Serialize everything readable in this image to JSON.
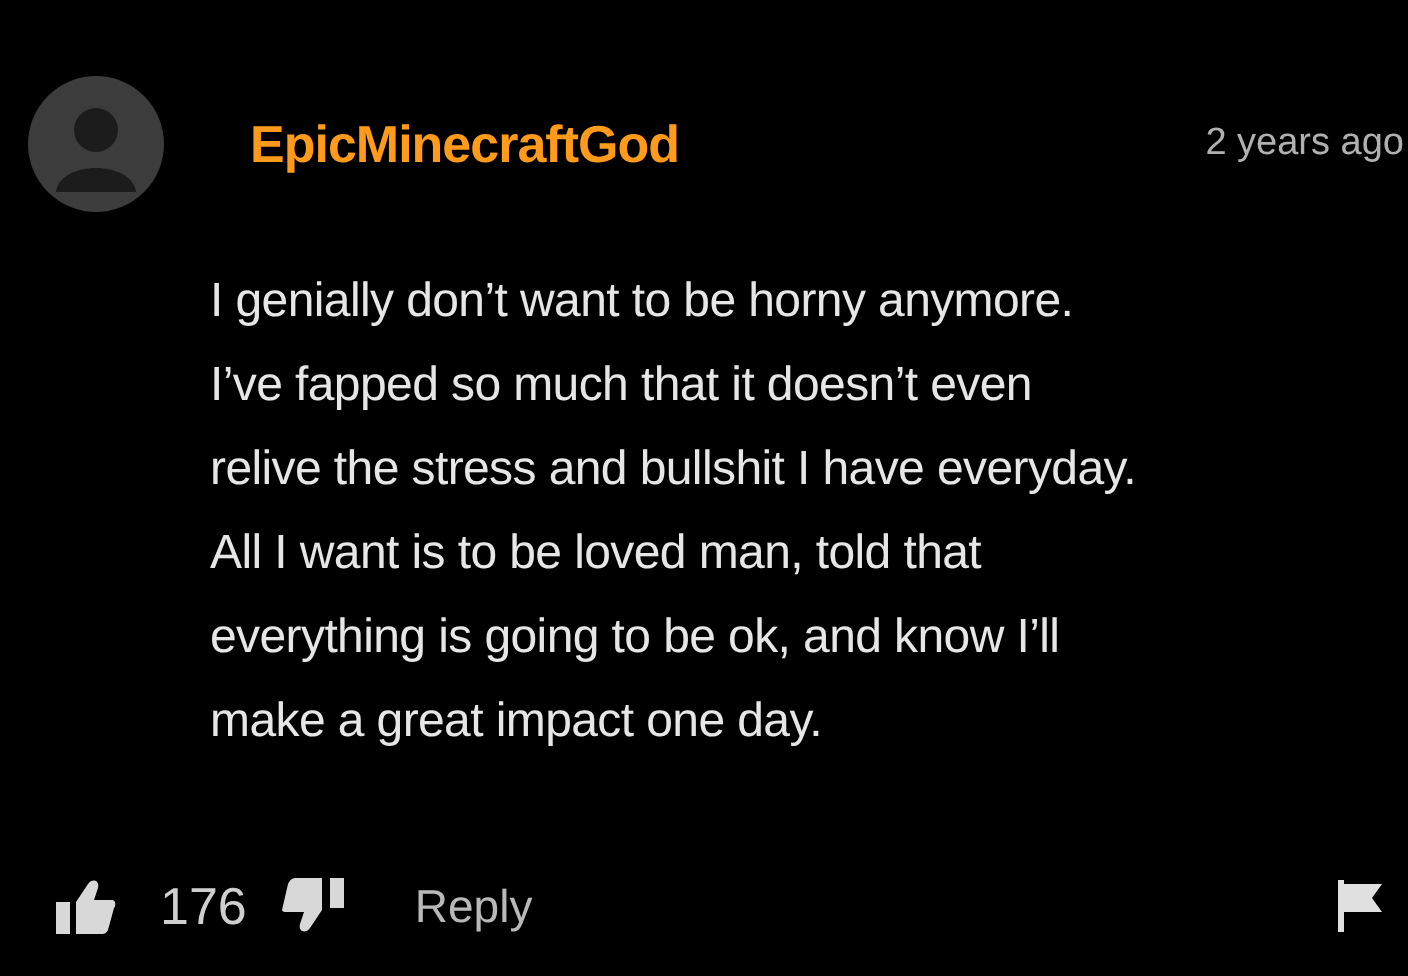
{
  "comment": {
    "author": "EpicMinecraftGod",
    "time": "2 years ago",
    "body_lines": [
      "I genially don’t want to be horny anymore.",
      "I’ve fapped so much that it doesn’t even",
      "relive the stress and bullshit I have everyday.",
      "All I want is to be loved man, told that",
      "everything is going to be ok, and know I’ll",
      "make a great impact one day."
    ],
    "likes": "176",
    "reply": "Reply"
  }
}
